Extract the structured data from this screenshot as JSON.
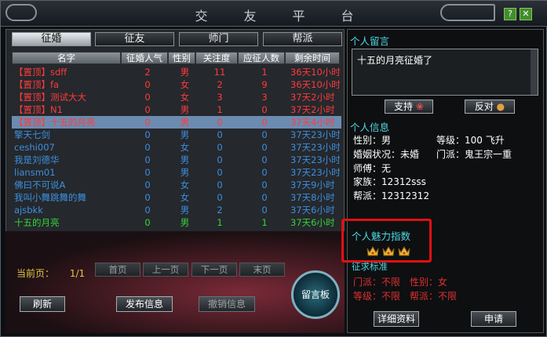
{
  "window": {
    "title": "交友平台"
  },
  "tabs": [
    {
      "label": "征婚",
      "active": true
    },
    {
      "label": "征友",
      "active": false
    },
    {
      "label": "师门",
      "active": false
    },
    {
      "label": "帮派",
      "active": false
    }
  ],
  "columns": [
    "名字",
    "征婚人气",
    "性别",
    "关注度",
    "应征人数",
    "剩余时间"
  ],
  "rows": [
    {
      "name": "【置顶】sdff",
      "pop": "2",
      "gender": "男",
      "attention": "11",
      "applicants": "1",
      "remaining": "36天10小时",
      "style": "red"
    },
    {
      "name": "【置顶】fa",
      "pop": "0",
      "gender": "女",
      "attention": "2",
      "applicants": "9",
      "remaining": "36天10小时",
      "style": "red"
    },
    {
      "name": "【置顶】测试大大",
      "pop": "0",
      "gender": "女",
      "attention": "3",
      "applicants": "3",
      "remaining": "37天2小时",
      "style": "red"
    },
    {
      "name": "【置顶】N1",
      "pop": "0",
      "gender": "男",
      "attention": "1",
      "applicants": "0",
      "remaining": "37天2小时",
      "style": "red"
    },
    {
      "name": "【置顶】十五的月亮",
      "pop": "0",
      "gender": "男",
      "attention": "0",
      "applicants": "0",
      "remaining": "37天4小时",
      "style": "red-sel"
    },
    {
      "name": "擎天七剑",
      "pop": "0",
      "gender": "男",
      "attention": "0",
      "applicants": "0",
      "remaining": "37天23小时",
      "style": "blue"
    },
    {
      "name": "ceshi007",
      "pop": "0",
      "gender": "女",
      "attention": "0",
      "applicants": "0",
      "remaining": "37天23小时",
      "style": "blue"
    },
    {
      "name": "我是刘德华",
      "pop": "0",
      "gender": "男",
      "attention": "0",
      "applicants": "0",
      "remaining": "37天23小时",
      "style": "blue"
    },
    {
      "name": "liansm01",
      "pop": "0",
      "gender": "男",
      "attention": "0",
      "applicants": "0",
      "remaining": "37天23小时",
      "style": "blue"
    },
    {
      "name": "佛曰不可说A",
      "pop": "0",
      "gender": "女",
      "attention": "0",
      "applicants": "0",
      "remaining": "37天9小时",
      "style": "blue"
    },
    {
      "name": "我叫小舞跳舞的舞",
      "pop": "0",
      "gender": "女",
      "attention": "0",
      "applicants": "0",
      "remaining": "37天8小时",
      "style": "blue"
    },
    {
      "name": "ajsbkk",
      "pop": "0",
      "gender": "男",
      "attention": "2",
      "applicants": "0",
      "remaining": "37天6小时",
      "style": "blue"
    },
    {
      "name": "十五的月亮",
      "pop": "0",
      "gender": "男",
      "attention": "1",
      "applicants": "1",
      "remaining": "37天6小时",
      "style": "green"
    }
  ],
  "pager": {
    "current_label": "当前页：",
    "current_value": "1/1",
    "first": "首页",
    "prev": "上一页",
    "next": "下一页",
    "last": "末页"
  },
  "actions": {
    "refresh": "刷新",
    "publish": "发布信息",
    "revoke": "撤销信息",
    "message_board": "留言板"
  },
  "right": {
    "message_title": "个人留言",
    "message_text": "十五的月亮征婚了",
    "support": "支持",
    "oppose": "反对",
    "info_title": "个人信息",
    "gender": "性别：男",
    "level": "等级：100 飞升",
    "marital": "婚姻状况：未婚",
    "sect": "门派：鬼王宗一重",
    "master": "师傅：无",
    "family": "家族：12312sss",
    "guild": "帮派：12312312",
    "charm_title": "个人魅力指数",
    "charm_crowns": 3,
    "requirements_title": "征求标准",
    "req_sect": "门派：不限",
    "req_gender": "性别：女",
    "req_level": "等级：不限",
    "req_guild": "帮派：不限",
    "details": "详细资料",
    "apply": "申请"
  },
  "colors": {
    "red": "#ff3b3b",
    "blue": "#3d8fe0",
    "green": "#35d43a",
    "cyan": "#4fd7e0",
    "gold": "#e2c44a"
  }
}
